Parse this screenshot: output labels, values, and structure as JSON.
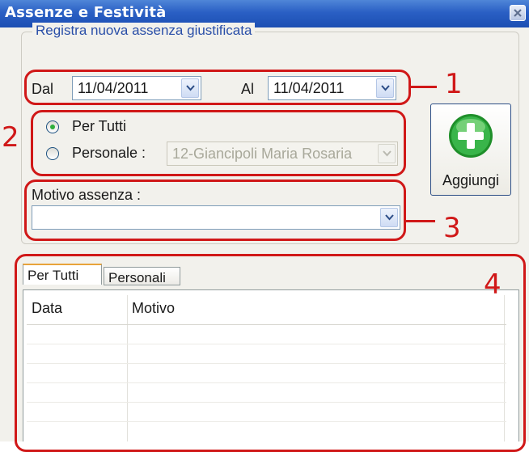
{
  "window": {
    "title": "Assenze e Festività"
  },
  "form": {
    "group_title": "Registra nuova assenza giustificata",
    "dal_label": "Dal",
    "dal_value": "11/04/2011",
    "al_label": "Al",
    "al_value": "11/04/2011",
    "radio_per_tutti": "Per Tutti",
    "radio_personale": "Personale :",
    "personale_value": "12-Giancipoli Maria Rosaria",
    "motivo_label": "Motivo assenza :",
    "motivo_value": "",
    "add_button": "Aggiungi"
  },
  "annotations": [
    "1",
    "2",
    "3",
    "4"
  ],
  "tabs": [
    {
      "label": "Per Tutti",
      "active": true
    },
    {
      "label": "Personali",
      "active": false
    }
  ],
  "grid": {
    "columns": [
      "Data",
      "Motivo"
    ]
  },
  "colors": {
    "annotation": "#d01818",
    "titlebar": "#2a5fc4",
    "accent_green": "#2fae3b"
  }
}
